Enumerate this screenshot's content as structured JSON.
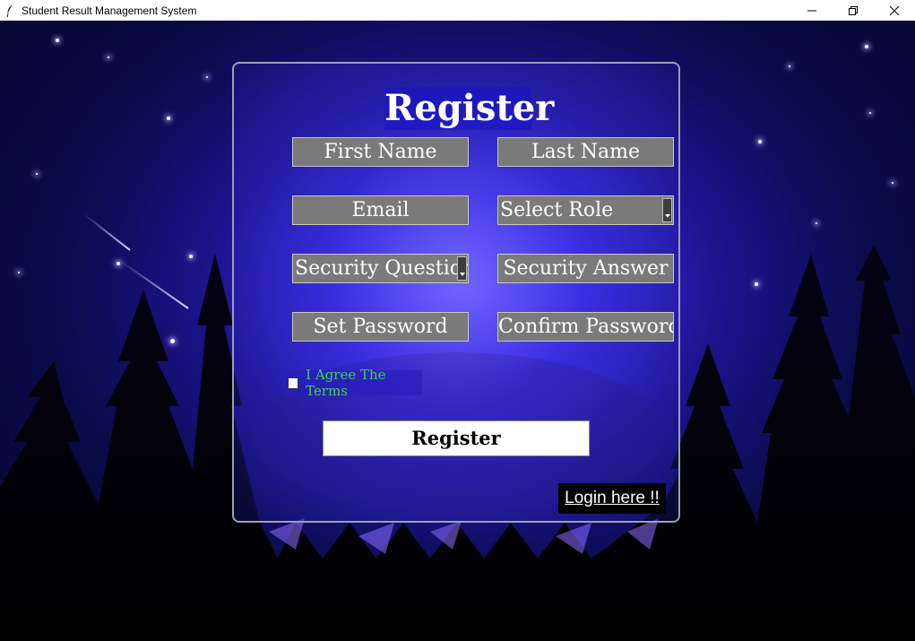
{
  "window": {
    "title": "Student Result Management System",
    "minimize_label": "─",
    "restore_label": "❐",
    "close_label": "✕"
  },
  "colors": {
    "sky_accent": "#3a2be0",
    "field_bg": "#7a7a7a",
    "terms_text": "#3cd44a",
    "button_bg": "#ffffff",
    "link_bg": "#000000"
  },
  "form": {
    "heading": "Register",
    "first_name": "First Name",
    "last_name": "Last Name",
    "email": "Email",
    "select_role": "Select Role",
    "security_question": "Security Question",
    "security_answer": "Security Answer",
    "set_password": "Set Password",
    "confirm_password": "Confirm Password",
    "terms_label": "I Agree The Terms",
    "terms_checked": false,
    "register_button": "Register",
    "login_link": "Login here !!"
  }
}
